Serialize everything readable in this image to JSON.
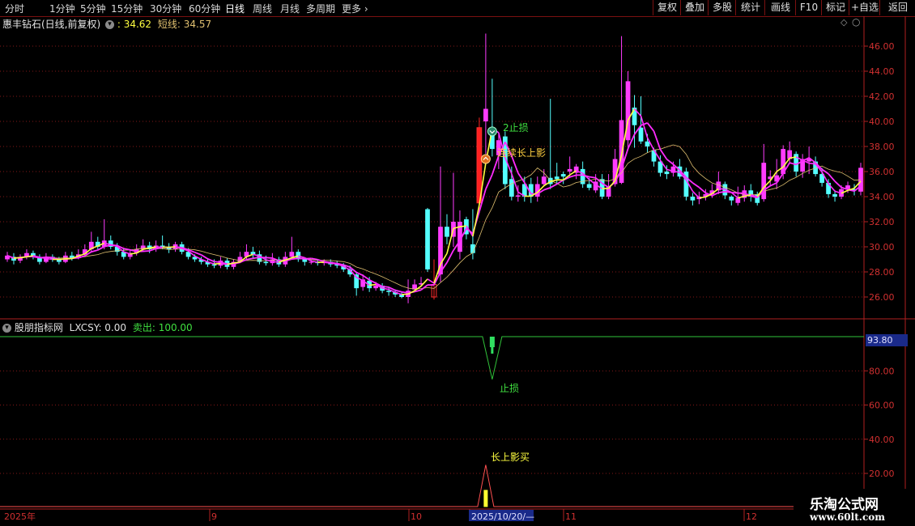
{
  "toolbar": {
    "periods": [
      "分时",
      "1分钟",
      "5分钟",
      "15分钟",
      "30分钟",
      "60分钟",
      "日线",
      "周线",
      "月线",
      "多周期",
      "更多"
    ],
    "active_period": "日线",
    "right_buttons": [
      "复权",
      "叠加",
      "多股",
      "统计",
      "画线",
      "F10",
      "标记",
      "+自选",
      "返回"
    ]
  },
  "main_chart": {
    "stock_name": "惠丰钻石(日线,前复权)",
    "ma1_value": ": 34.62",
    "ma2_label": "短线: 34.57",
    "y_ticks": [
      "46.00",
      "44.00",
      "42.00",
      "40.00",
      "38.00",
      "36.00",
      "34.00",
      "32.00",
      "30.00",
      "28.00",
      "26.00"
    ],
    "annotations": [
      "2止损",
      "连续长上影"
    ]
  },
  "indicator": {
    "name": "股朋指标网",
    "lxcsy_label": "LXCSY: 0.00",
    "sell_label": "卖出: 100.00",
    "current_value": "93.80",
    "y_ticks": [
      "80.00",
      "60.00",
      "40.00",
      "20.00"
    ],
    "stop_loss_label": "止损",
    "buy_label": "长上影买"
  },
  "time_axis": {
    "labels": [
      "2025年",
      "9",
      "10",
      "2025/10/20/—",
      "11",
      "12"
    ]
  },
  "watermark": {
    "title": "乐淘公式网",
    "url": "www.60lt.com"
  },
  "colors": {
    "up_candle": "#ff3cff",
    "down_candle": "#54ffff",
    "ma_short": "#ffff40",
    "ma_long": "#ff2cff",
    "ma_thin": "#e0c070",
    "axis_red": "#b02020",
    "indicator_line": "#31c43a"
  },
  "chart_data": {
    "type": "candlestick",
    "y_unit": "price",
    "ylim": [
      25,
      47.5
    ],
    "series_order": [
      "open",
      "close",
      "high",
      "low"
    ],
    "candles": [
      [
        29.0,
        29.3,
        29.6,
        28.8
      ],
      [
        29.2,
        28.9,
        29.5,
        28.6
      ],
      [
        28.9,
        29.2,
        29.4,
        28.7
      ],
      [
        29.2,
        29.5,
        29.8,
        29.0
      ],
      [
        29.5,
        29.2,
        29.7,
        29.0
      ],
      [
        29.2,
        28.8,
        29.4,
        28.6
      ],
      [
        28.8,
        29.2,
        29.5,
        28.7
      ],
      [
        29.2,
        29.0,
        29.4,
        28.8
      ],
      [
        29.0,
        28.8,
        29.2,
        28.6
      ],
      [
        28.8,
        29.3,
        29.6,
        28.7
      ],
      [
        29.3,
        29.1,
        29.6,
        28.9
      ],
      [
        29.1,
        29.4,
        29.8,
        29.0
      ],
      [
        29.4,
        29.8,
        30.2,
        29.2
      ],
      [
        29.8,
        30.4,
        31.2,
        29.6
      ],
      [
        30.4,
        30.0,
        30.8,
        29.8
      ],
      [
        30.0,
        30.5,
        32.2,
        29.8
      ],
      [
        30.5,
        30.0,
        30.9,
        29.8
      ],
      [
        30.0,
        29.6,
        30.3,
        29.3
      ],
      [
        29.6,
        29.2,
        29.9,
        29.0
      ],
      [
        29.2,
        29.5,
        29.8,
        29.0
      ],
      [
        29.5,
        29.8,
        30.2,
        29.3
      ],
      [
        29.8,
        30.1,
        30.6,
        29.6
      ],
      [
        30.1,
        29.8,
        30.4,
        29.5
      ],
      [
        29.8,
        30.1,
        30.5,
        29.6
      ],
      [
        30.1,
        30.0,
        30.9,
        29.8
      ],
      [
        30.0,
        29.8,
        30.3,
        29.5
      ],
      [
        29.8,
        30.2,
        30.4,
        29.6
      ],
      [
        30.2,
        29.6,
        30.4,
        29.4
      ],
      [
        29.6,
        29.2,
        29.9,
        29.0
      ],
      [
        29.2,
        29.0,
        29.4,
        28.8
      ],
      [
        29.0,
        28.8,
        29.2,
        28.6
      ],
      [
        28.8,
        28.6,
        29.1,
        28.4
      ],
      [
        28.6,
        28.5,
        29.0,
        28.3
      ],
      [
        28.5,
        28.9,
        29.2,
        28.3
      ],
      [
        28.9,
        28.4,
        29.1,
        28.2
      ],
      [
        28.4,
        28.8,
        29.0,
        28.2
      ],
      [
        28.8,
        29.2,
        29.6,
        28.7
      ],
      [
        29.2,
        29.6,
        30.2,
        29.0
      ],
      [
        29.6,
        29.4,
        30.0,
        29.1
      ],
      [
        29.4,
        28.8,
        29.7,
        28.6
      ],
      [
        28.8,
        28.7,
        29.3,
        28.5
      ],
      [
        28.7,
        29.0,
        29.5,
        28.5
      ],
      [
        29.0,
        28.6,
        29.2,
        28.4
      ],
      [
        28.6,
        29.2,
        29.6,
        28.4
      ],
      [
        29.2,
        29.6,
        30.8,
        29.0
      ],
      [
        29.6,
        29.0,
        29.8,
        28.8
      ],
      [
        29.0,
        28.8,
        29.1,
        28.5
      ],
      [
        28.8,
        28.8,
        29.0,
        28.6
      ],
      [
        28.8,
        28.7,
        29.0,
        28.5
      ],
      [
        28.7,
        28.8,
        29.0,
        28.5
      ],
      [
        28.8,
        28.6,
        29.0,
        28.4
      ],
      [
        28.6,
        28.5,
        28.9,
        28.3
      ],
      [
        28.5,
        28.2,
        28.7,
        28.0
      ],
      [
        28.2,
        27.8,
        28.5,
        27.6
      ],
      [
        27.8,
        26.7,
        28.0,
        26.1
      ],
      [
        26.8,
        27.4,
        27.8,
        26.5
      ],
      [
        27.3,
        26.7,
        27.6,
        26.4
      ],
      [
        26.7,
        26.9,
        27.2,
        26.5
      ],
      [
        26.9,
        26.5,
        27.1,
        26.3
      ],
      [
        26.5,
        26.4,
        26.8,
        26.1
      ],
      [
        26.4,
        26.2,
        26.6,
        26.0
      ],
      [
        26.2,
        26.0,
        26.4,
        25.9
      ],
      [
        26.0,
        26.5,
        27.4,
        25.5
      ],
      [
        26.6,
        27.0,
        27.4,
        26.4
      ],
      [
        27.0,
        27.1,
        27.6,
        26.8
      ],
      [
        33.0,
        28.2,
        33.1,
        28.0
      ],
      [
        27.0,
        26.0,
        29.0,
        25.8
      ],
      [
        27.8,
        31.6,
        36.4,
        27.2
      ],
      [
        31.6,
        30.8,
        32.6,
        30.2
      ],
      [
        30.8,
        32.0,
        35.9,
        30.0
      ],
      [
        29.6,
        32.0,
        32.9,
        29.0
      ],
      [
        32.2,
        31.0,
        32.4,
        30.6
      ],
      [
        30.2,
        29.5,
        33.0,
        29.0
      ],
      [
        33.5,
        39.5,
        40.3,
        33.0
      ],
      [
        40.0,
        41.0,
        47.0,
        37.4
      ],
      [
        39.3,
        37.8,
        43.4,
        37.2
      ],
      [
        37.3,
        38.5,
        39.0,
        36.2
      ],
      [
        38.8,
        35.0,
        39.2,
        34.6
      ],
      [
        35.4,
        34.0,
        36.4,
        33.7
      ],
      [
        34.0,
        34.1,
        34.9,
        33.6
      ],
      [
        35.0,
        34.0,
        35.6,
        33.6
      ],
      [
        35.0,
        34.0,
        35.5,
        33.5
      ],
      [
        34.0,
        35.0,
        35.6,
        33.6
      ],
      [
        35.0,
        35.6,
        36.2,
        34.8
      ],
      [
        35.5,
        35.0,
        41.8,
        34.6
      ],
      [
        35.6,
        35.4,
        36.7,
        35.0
      ],
      [
        35.8,
        35.6,
        36.0,
        35.0
      ],
      [
        36.0,
        36.2,
        37.2,
        35.5
      ],
      [
        35.9,
        36.4,
        36.6,
        35.4
      ],
      [
        36.2,
        35.0,
        36.8,
        34.7
      ],
      [
        35.0,
        34.7,
        35.5,
        34.5
      ],
      [
        34.5,
        35.2,
        35.8,
        34.3
      ],
      [
        35.4,
        34.0,
        35.8,
        33.8
      ],
      [
        34.0,
        34.8,
        35.8,
        33.8
      ],
      [
        35.0,
        37.0,
        37.8,
        34.8
      ],
      [
        35.1,
        40.1,
        46.8,
        35.0
      ],
      [
        38.5,
        43.2,
        44.0,
        37.7
      ],
      [
        41.1,
        39.7,
        42.1,
        37.9
      ],
      [
        39.5,
        38.4,
        42.0,
        38.2
      ],
      [
        38.4,
        38.0,
        39.0,
        37.5
      ],
      [
        37.7,
        36.8,
        37.9,
        36.4
      ],
      [
        36.8,
        35.9,
        37.3,
        35.6
      ],
      [
        36.0,
        35.8,
        36.5,
        35.4
      ],
      [
        35.9,
        36.4,
        36.8,
        35.6
      ],
      [
        36.4,
        35.6,
        37.0,
        35.4
      ],
      [
        36.0,
        34.0,
        36.3,
        33.7
      ],
      [
        34.0,
        33.7,
        34.3,
        33.3
      ],
      [
        33.8,
        34.0,
        34.4,
        33.4
      ],
      [
        34.0,
        34.2,
        34.6,
        33.7
      ],
      [
        34.2,
        34.5,
        35.0,
        33.9
      ],
      [
        34.5,
        35.2,
        36.0,
        34.2
      ],
      [
        35.0,
        34.1,
        35.2,
        33.8
      ],
      [
        34.0,
        33.7,
        34.1,
        33.3
      ],
      [
        33.5,
        33.9,
        34.8,
        33.3
      ],
      [
        33.9,
        34.5,
        34.9,
        33.6
      ],
      [
        34.5,
        34.0,
        35.0,
        33.6
      ],
      [
        34.2,
        33.5,
        34.4,
        33.3
      ],
      [
        33.8,
        36.7,
        38.2,
        33.6
      ],
      [
        35.4,
        35.6,
        36.1,
        34.8
      ],
      [
        35.2,
        35.7,
        37.0,
        34.6
      ],
      [
        35.8,
        37.8,
        38.1,
        35.4
      ],
      [
        37.0,
        37.7,
        38.4,
        36.6
      ],
      [
        37.4,
        36.0,
        37.6,
        35.6
      ],
      [
        36.0,
        37.0,
        37.4,
        35.5
      ],
      [
        36.8,
        37.0,
        38.0,
        35.8
      ],
      [
        36.8,
        35.8,
        37.2,
        35.6
      ],
      [
        35.8,
        35.1,
        36.3,
        34.8
      ],
      [
        35.1,
        34.2,
        35.4,
        33.9
      ],
      [
        34.2,
        34.0,
        34.5,
        33.6
      ],
      [
        34.0,
        34.6,
        34.9,
        33.8
      ],
      [
        34.6,
        34.9,
        35.2,
        34.3
      ],
      [
        34.6,
        34.5,
        35.0,
        34.1
      ],
      [
        34.4,
        36.3,
        36.7,
        34.1
      ]
    ],
    "indicator_series": {
      "name": "LXCSY",
      "ylim": [
        0,
        110
      ],
      "baseline": 100,
      "stop_loss_index": 75,
      "stop_loss_value": 75,
      "buy_index": 74,
      "buy_peak_value": 25
    }
  }
}
